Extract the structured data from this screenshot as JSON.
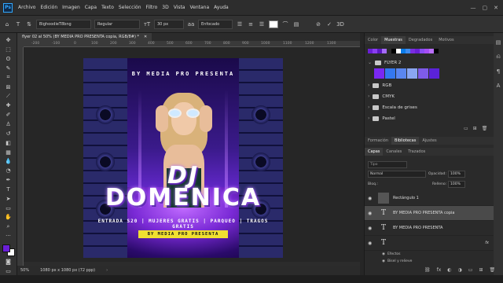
{
  "app": {
    "logo": "Ps",
    "window_controls": [
      "—",
      "▢",
      "✕"
    ]
  },
  "menu": {
    "items": [
      "Archivo",
      "Edición",
      "Imagen",
      "Capa",
      "Texto",
      "Selección",
      "Filtro",
      "3D",
      "Vista",
      "Ventana",
      "Ayuda"
    ]
  },
  "options": {
    "font_family": "BighoodieT8bng",
    "font_style": "Regular",
    "font_size": "30 px",
    "antialias": "Enfocado",
    "text_color": "#ffffff"
  },
  "document": {
    "tab_title": "flyer 02 al 50% (BY MEDIA PRO PRESENTA copia, RGB/8#) *",
    "close": "✕",
    "ruler_marks": [
      "-200",
      "-100",
      "0",
      "100",
      "200",
      "300",
      "400",
      "500",
      "600",
      "700",
      "800",
      "900",
      "1000",
      "1100",
      "1200",
      "1300"
    ],
    "zoom": "50%",
    "doc_info": "1080 px x 1080 px (72 ppp)"
  },
  "flyer": {
    "header": "BY MEDIA PRO PRESENTA",
    "line1": "DJ",
    "line2": "DOMENICA",
    "info": "ENTRADA S20 | MUJERES GRATIS | PARQUEO | TRAGOS GRATIS",
    "pill": "BY MEDIA PRO PRESENTA"
  },
  "swatches_panel": {
    "tabs": [
      "Color",
      "Muestras",
      "Degradados",
      "Motivos"
    ],
    "active_tab": "Muestras",
    "recent_colors": [
      "#6a1fd6",
      "#8a3df0",
      "#5b18c2",
      "#a56bf7",
      "#2b2b2b",
      "#000000",
      "#ffffff",
      "#0a7be8",
      "#3e8cf0",
      "#7a2de0",
      "#6a1fd6",
      "#8a4cf2",
      "#a64df5",
      "#b96ff8",
      "#000000"
    ],
    "group_name": "FLYER 2",
    "group_colors": [
      "#7a28f2",
      "#3478f0",
      "#5a86f0",
      "#8aa6f2",
      "#7e5be8",
      "#5b22d8"
    ],
    "folders": [
      "RGB",
      "CMYK",
      "Escala de grises",
      "Pastel"
    ]
  },
  "lower_tabs": {
    "row1": [
      "Formación",
      "Bibliotecas",
      "Ajustes"
    ],
    "row1_active": "Bibliotecas",
    "row2": [
      "Capas",
      "Canales",
      "Trazados"
    ],
    "row2_active": "Capas"
  },
  "layers_panel": {
    "search_placeholder": "Tipo",
    "blend_mode": "Normal",
    "opacity_label": "Opacidad:",
    "opacity": "100%",
    "lock_label": "Bloq.:",
    "fill_label": "Relleno:",
    "fill": "100%",
    "layers": [
      {
        "name": "Rectángulo 1",
        "kind": "shape",
        "selected": false
      },
      {
        "name": "BY MEDIA PRO PRESENTA copia",
        "kind": "text",
        "selected": true
      },
      {
        "name": "BY MEDIA PRO PRESENTA",
        "kind": "text",
        "selected": false
      },
      {
        "name": "",
        "kind": "text",
        "selected": false,
        "fx": "fx"
      }
    ],
    "effects_label": "Efectos",
    "effect": "Bisel y relieve"
  }
}
